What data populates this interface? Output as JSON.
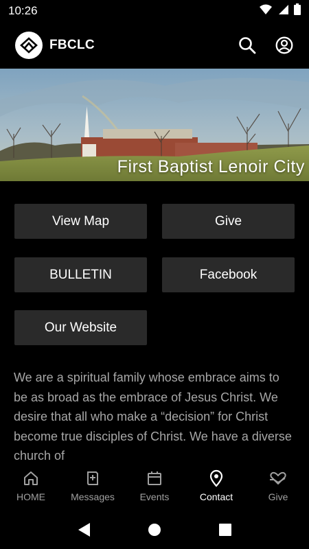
{
  "status": {
    "time": "10:26"
  },
  "app": {
    "title": "FBCLC"
  },
  "banner": {
    "caption": "First Baptist Lenoir City"
  },
  "buttons": {
    "view_map": "View Map",
    "give": "Give",
    "bulletin": "BULLETIN",
    "facebook": "Facebook",
    "website": "Our Website"
  },
  "description": "We are a spiritual family whose embrace aims to be as broad as the embrace of Jesus Christ.  We desire that all who make a “decision” for Christ become true disciples of Christ.  We have a diverse church of",
  "nav": {
    "active": "Contact",
    "items": [
      {
        "label": "HOME",
        "icon": "home-icon"
      },
      {
        "label": "Messages",
        "icon": "book-plus-icon"
      },
      {
        "label": "Events",
        "icon": "calendar-icon"
      },
      {
        "label": "Contact",
        "icon": "location-pin-icon"
      },
      {
        "label": "Give",
        "icon": "heart-hand-icon"
      }
    ]
  },
  "colors": {
    "background": "#000000",
    "button": "#2a2a2a",
    "body_text": "#a7a7a7",
    "inactive_nav": "#a0a0a0"
  }
}
